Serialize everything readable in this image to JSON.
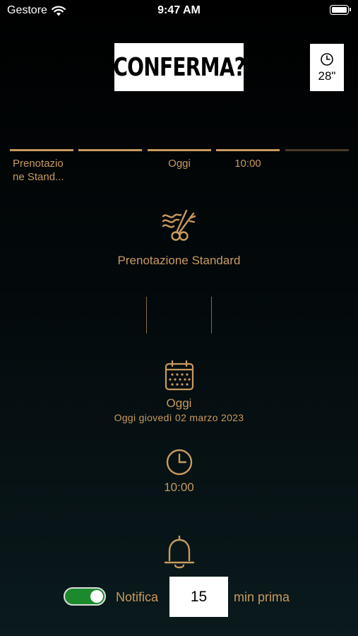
{
  "status_bar": {
    "carrier": "Gestore",
    "time": "9:47 AM"
  },
  "header": {
    "title": "CONFERMA?",
    "timer": "28\""
  },
  "steps": [
    {
      "label": "Prenotazio\nne Stand...",
      "active": true
    },
    {
      "label": "",
      "active": true
    },
    {
      "label": "Oggi",
      "active": true
    },
    {
      "label": "10:00",
      "active": true
    },
    {
      "label": "",
      "active": false
    }
  ],
  "service": {
    "icon": "scissors-wave-icon",
    "name": "Prenotazione Standard"
  },
  "date": {
    "icon": "calendar-icon",
    "main": "Oggi",
    "sub": "Oggi giovedì 02 marzo 2023"
  },
  "time": {
    "icon": "clock-icon",
    "main": "10:00"
  },
  "notification": {
    "icon": "bell-icon",
    "enabled": true,
    "label": "Notifica",
    "minutes": "15",
    "suffix": "min prima"
  },
  "colors": {
    "accent": "#c89a5e",
    "toggle_on": "#1c8a2c",
    "background": "#000000"
  }
}
